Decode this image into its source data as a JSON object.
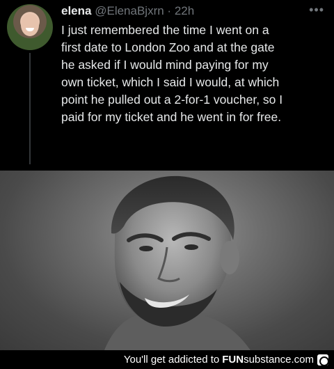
{
  "tweet": {
    "name": "elena",
    "handle": "@ElenaBjxrn",
    "separator": "·",
    "time": "22h",
    "more": "•••",
    "lines": [
      "I just remembered the time I went on a",
      "first date to London Zoo and at the gate",
      "he asked if I would mind paying for my",
      "own ticket, which I said I would, at which",
      "point he pulled out a 2-for-1 voucher, so I",
      "paid for my ticket and he went in for free."
    ]
  },
  "footer": {
    "prefix": "You'll get addicted to",
    "brand_fun": "FUN",
    "brand_sub": "substance",
    "brand_tld": ".com"
  }
}
